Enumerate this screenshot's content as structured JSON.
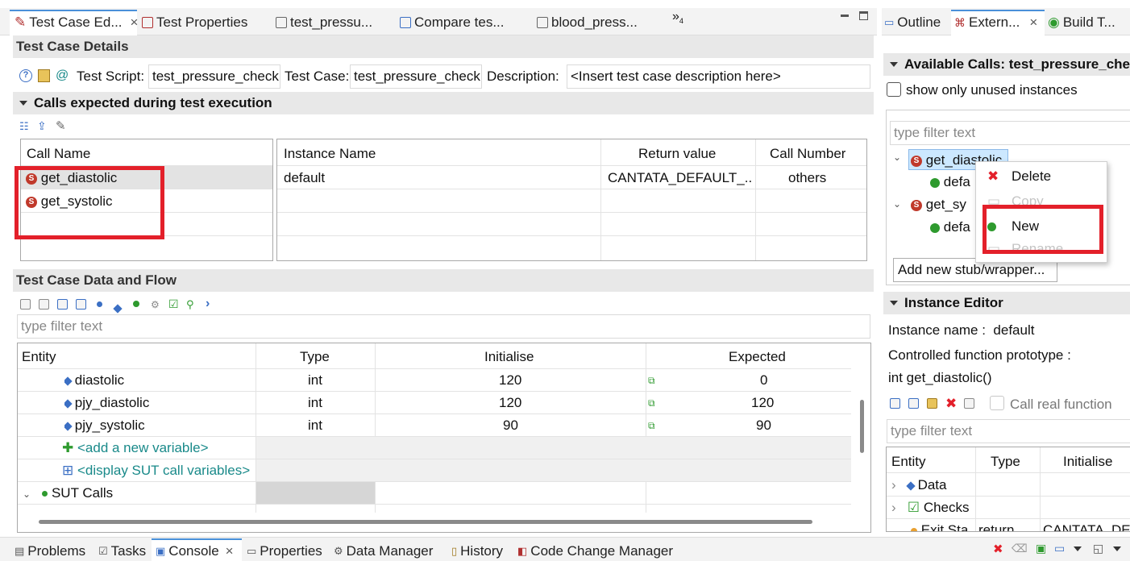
{
  "top_tabs": [
    {
      "label": "Test Case Ed...",
      "close": "×",
      "active": true
    },
    {
      "label": "Test Properties"
    },
    {
      "label": "test_pressu..."
    },
    {
      "label": "Compare tes..."
    },
    {
      "label": "blood_press..."
    }
  ],
  "overflow_label": "»",
  "overflow_count": "4",
  "right_tabs": [
    {
      "label": "Outline"
    },
    {
      "label": "Extern...",
      "close": "×",
      "active": true
    },
    {
      "label": "Build T..."
    }
  ],
  "details": {
    "header": "Test Case Details",
    "script_label": "Test Script:",
    "script_value": "test_pressure_check",
    "case_label": "Test Case:",
    "case_value": "test_pressure_check",
    "desc_label": "Description:",
    "desc_value": "<Insert test case description here>"
  },
  "calls": {
    "header": "Calls expected during test execution",
    "col_call_name": "Call Name",
    "names": [
      "get_diastolic",
      "get_systolic"
    ],
    "cols": {
      "instance": "Instance Name",
      "return": "Return value",
      "number": "Call Number"
    },
    "row": {
      "instance": "default",
      "return": "CANTATA_DEFAULT_...",
      "number": "others"
    }
  },
  "flow": {
    "header": "Test Case Data and Flow",
    "filter_placeholder": "type filter text",
    "cols": {
      "entity": "Entity",
      "type": "Type",
      "init": "Initialise",
      "expected": "Expected"
    },
    "rows": [
      {
        "entity": "diastolic",
        "type": "int",
        "init": "120",
        "expected": "0"
      },
      {
        "entity": "pjy_diastolic",
        "type": "int",
        "init": "120",
        "expected": "120"
      },
      {
        "entity": "pjy_systolic",
        "type": "int",
        "init": "90",
        "expected": "90"
      }
    ],
    "add_var": "<add a new variable>",
    "display_sut": "<display SUT call variables>",
    "sut_calls": "SUT Calls"
  },
  "available": {
    "header": "Available Calls: test_pressure_chec",
    "show_unused": "show only unused instances",
    "filter_placeholder": "type filter text",
    "tree": [
      {
        "name": "get_diastolic",
        "child": "defa"
      },
      {
        "name": "get_sy",
        "child": "defa"
      }
    ],
    "add_button": "Add new stub/wrapper..."
  },
  "context_menu": {
    "items": [
      {
        "label": "Delete",
        "icon": "delete-icon",
        "enabled": true
      },
      {
        "label": "Copy",
        "icon": "copy-icon",
        "enabled": false
      },
      {
        "label": "New",
        "icon": "new-icon",
        "enabled": true
      },
      {
        "label": "Rename",
        "icon": "rename-icon",
        "enabled": false
      }
    ]
  },
  "instance_editor": {
    "header": "Instance Editor",
    "name_line": "Instance name :  default",
    "proto_label": "Controlled function prototype :",
    "proto_value": "int get_diastolic()",
    "call_real": "Call real function",
    "filter_placeholder": "type filter text",
    "cols": {
      "entity": "Entity",
      "type": "Type",
      "init": "Initialise"
    },
    "rows": [
      {
        "entity": "Data",
        "type": "",
        "init": ""
      },
      {
        "entity": "Checks",
        "type": "",
        "init": ""
      },
      {
        "entity": "Exit Sta",
        "type": "return",
        "init": "CANTATA_DE"
      }
    ]
  },
  "bottom_tabs": [
    {
      "label": "Problems"
    },
    {
      "label": "Tasks"
    },
    {
      "label": "Console",
      "close": "×",
      "active": true
    },
    {
      "label": "Properties"
    },
    {
      "label": "Data Manager"
    },
    {
      "label": "History"
    },
    {
      "label": "Code Change Manager"
    }
  ],
  "colors": {
    "highlight": "#e3202a",
    "selection": "#cce8ff",
    "header_bg": "#e8e8e8"
  }
}
